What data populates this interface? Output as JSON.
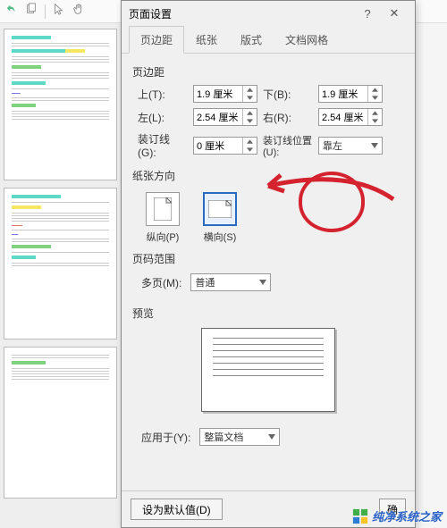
{
  "dialog": {
    "title": "页面设置",
    "tabs": [
      "页边距",
      "纸张",
      "版式",
      "文档网格"
    ],
    "active_tab": 0,
    "margins": {
      "section_label": "页边距",
      "top_label": "上(T):",
      "top_value": "1.9 厘米",
      "bottom_label": "下(B):",
      "bottom_value": "1.9 厘米",
      "left_label": "左(L):",
      "left_value": "2.54 厘米",
      "right_label": "右(R):",
      "right_value": "2.54 厘米",
      "gutter_label": "装订线(G):",
      "gutter_value": "0 厘米",
      "gutter_pos_label": "装订线位置(U):",
      "gutter_pos_value": "靠左"
    },
    "orientation": {
      "section_label": "纸张方向",
      "portrait_label": "纵向(P)",
      "landscape_label": "横向(S)",
      "selected": "landscape"
    },
    "page_range": {
      "section_label": "页码范围",
      "multi_label": "多页(M):",
      "multi_value": "普通"
    },
    "preview": {
      "section_label": "预览"
    },
    "apply": {
      "label": "应用于(Y):",
      "value": "整篇文档"
    },
    "footer": {
      "default_btn": "设为默认值(D)",
      "ok_btn": "确"
    }
  },
  "watermark": "纯净系统之家"
}
